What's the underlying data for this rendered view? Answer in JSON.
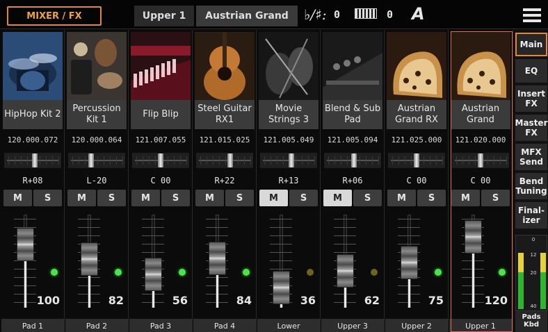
{
  "header": {
    "mode_button": "MIXER / FX",
    "track_label": "Upper 1",
    "track_sound": "Austrian Grand",
    "key_symbol": "♭/♯:",
    "key_value": "0",
    "transpose_value": "0",
    "chord_symbol": "A"
  },
  "channels": [
    {
      "name": "HipHop Kit 2",
      "bank": "120.000.072",
      "pan": "R+08",
      "pan_pos": 0.54,
      "mute": false,
      "solo": false,
      "volume": "100",
      "volume_level": 1.0,
      "led": "on",
      "footer": "Pad 1",
      "photo": "drumkit"
    },
    {
      "name": "Percussion Kit 1",
      "bank": "120.000.064",
      "pan": "L-20",
      "pan_pos": 0.38,
      "mute": false,
      "solo": false,
      "volume": "82",
      "volume_level": 0.78,
      "led": "on",
      "footer": "Pad 2",
      "photo": "percussion"
    },
    {
      "name": "Flip Blip",
      "bank": "121.007.055",
      "pan": "C 00",
      "pan_pos": 0.5,
      "mute": false,
      "solo": false,
      "volume": "56",
      "volume_level": 0.55,
      "led": "on",
      "footer": "Pad 3",
      "photo": "synth"
    },
    {
      "name": "Steel Guitar RX1",
      "bank": "121.015.025",
      "pan": "R+22",
      "pan_pos": 0.62,
      "mute": false,
      "solo": false,
      "volume": "84",
      "volume_level": 0.79,
      "led": "on",
      "footer": "Pad 4",
      "photo": "guitar"
    },
    {
      "name": "Movie Strings 3",
      "bank": "121.005.049",
      "pan": "R+13",
      "pan_pos": 0.56,
      "mute": true,
      "solo": false,
      "volume": "36",
      "volume_level": 0.35,
      "led": "off",
      "footer": "Lower",
      "photo": "strings"
    },
    {
      "name": "Blend & Sub Pad",
      "bank": "121.005.094",
      "pan": "R+06",
      "pan_pos": 0.53,
      "mute": true,
      "solo": false,
      "volume": "62",
      "volume_level": 0.6,
      "led": "off",
      "footer": "Upper 3",
      "photo": "pad"
    },
    {
      "name": "Austrian Grand RX",
      "bank": "121.025.000",
      "pan": "C 00",
      "pan_pos": 0.5,
      "mute": false,
      "solo": false,
      "volume": "75",
      "volume_level": 0.73,
      "led": "on",
      "footer": "Upper 2",
      "photo": "piano"
    },
    {
      "name": "Austrian Grand",
      "bank": "121.020.000",
      "pan": "C 00",
      "pan_pos": 0.5,
      "mute": false,
      "solo": false,
      "volume": "120",
      "volume_level": 1.12,
      "led": "on",
      "footer": "Upper 1",
      "photo": "piano",
      "selected": true
    }
  ],
  "buttons": {
    "mute": "M",
    "solo": "S"
  },
  "tabs": [
    "Main",
    "EQ",
    "Insert FX",
    "Master FX",
    "MFX Send",
    "Bend Tuning",
    "Final- izer"
  ],
  "active_tab": "Main",
  "meter": {
    "marks": [
      "0",
      "12",
      "20",
      "40"
    ],
    "left_level": 0.78,
    "right_level": 0.78
  },
  "pads_kbd": "Pads Kbd",
  "colors": {
    "accent": "#e58a2c",
    "selection": "#e2685a",
    "led_on": "#4ee04e"
  },
  "icons": {
    "menu": "hamburger-menu-icon",
    "keyboard": "keyboard-icon"
  }
}
